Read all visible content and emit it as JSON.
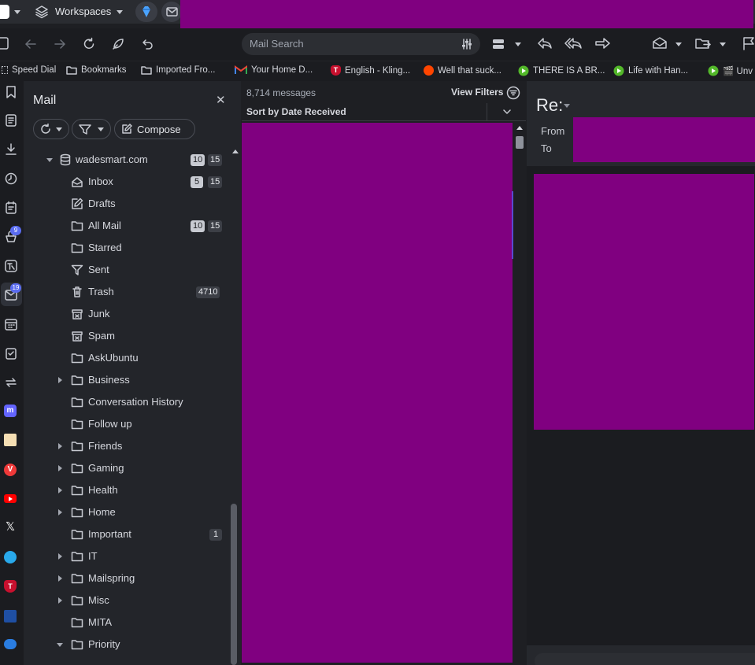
{
  "tabbar": {
    "workspaces_label": "Workspaces"
  },
  "toolbar": {
    "search_placeholder": "Mail Search"
  },
  "bookmarks": [
    {
      "label": "Speed Dial",
      "icon": "grid-icon"
    },
    {
      "label": "Bookmarks",
      "icon": "folder-icon"
    },
    {
      "label": "Imported Fro...",
      "icon": "folder-icon"
    },
    {
      "label": "Your Home D...",
      "icon": "gmail-icon"
    },
    {
      "label": "English - Kling...",
      "icon": "shield-icon"
    },
    {
      "label": "Well that suck...",
      "icon": "reddit-icon"
    },
    {
      "label": "THERE IS A BR...",
      "icon": "play-icon"
    },
    {
      "label": "Life with Han...",
      "icon": "play-icon"
    },
    {
      "label": "🎬 Unv",
      "icon": "play-icon"
    }
  ],
  "rail": {
    "feeds_badge": "9",
    "mail_badge": "19"
  },
  "mail": {
    "title": "Mail",
    "compose_label": "Compose",
    "account": {
      "name": "wadesmart.com",
      "unread": "10",
      "total": "15"
    },
    "folders": [
      {
        "name": "Inbox",
        "icon": "inbox-icon",
        "unread": "5",
        "total": "15",
        "expand": "none"
      },
      {
        "name": "Drafts",
        "icon": "draft-icon",
        "unread": "",
        "total": "",
        "expand": "none"
      },
      {
        "name": "All Mail",
        "icon": "folder-icon",
        "unread": "10",
        "total": "15",
        "expand": "none"
      },
      {
        "name": "Starred",
        "icon": "folder-icon",
        "unread": "",
        "total": "",
        "expand": "none"
      },
      {
        "name": "Sent",
        "icon": "sent-icon",
        "unread": "",
        "total": "",
        "expand": "none"
      },
      {
        "name": "Trash",
        "icon": "trash-icon",
        "unread": "",
        "total": "4710",
        "expand": "none"
      },
      {
        "name": "Junk",
        "icon": "junk-icon",
        "unread": "",
        "total": "",
        "expand": "none"
      },
      {
        "name": "Spam",
        "icon": "junk-icon",
        "unread": "",
        "total": "",
        "expand": "none"
      },
      {
        "name": "AskUbuntu",
        "icon": "folder-icon",
        "unread": "",
        "total": "",
        "expand": "none"
      },
      {
        "name": "Business",
        "icon": "folder-icon",
        "unread": "",
        "total": "",
        "expand": "collapsed"
      },
      {
        "name": "Conversation History",
        "icon": "folder-icon",
        "unread": "",
        "total": "",
        "expand": "none"
      },
      {
        "name": "Follow up",
        "icon": "folder-icon",
        "unread": "",
        "total": "",
        "expand": "none"
      },
      {
        "name": "Friends",
        "icon": "folder-icon",
        "unread": "",
        "total": "",
        "expand": "collapsed"
      },
      {
        "name": "Gaming",
        "icon": "folder-icon",
        "unread": "",
        "total": "",
        "expand": "collapsed"
      },
      {
        "name": "Health",
        "icon": "folder-icon",
        "unread": "",
        "total": "",
        "expand": "collapsed"
      },
      {
        "name": "Home",
        "icon": "folder-icon",
        "unread": "",
        "total": "",
        "expand": "collapsed"
      },
      {
        "name": "Important",
        "icon": "folder-icon",
        "unread": "",
        "total": "1",
        "expand": "none"
      },
      {
        "name": "IT",
        "icon": "folder-icon",
        "unread": "",
        "total": "",
        "expand": "collapsed"
      },
      {
        "name": "Mailspring",
        "icon": "folder-icon",
        "unread": "",
        "total": "",
        "expand": "collapsed"
      },
      {
        "name": "Misc",
        "icon": "folder-icon",
        "unread": "",
        "total": "",
        "expand": "collapsed"
      },
      {
        "name": "MITA",
        "icon": "folder-icon",
        "unread": "",
        "total": "",
        "expand": "none"
      },
      {
        "name": "Priority",
        "icon": "folder-icon",
        "unread": "",
        "total": "",
        "expand": "expanded"
      }
    ]
  },
  "list": {
    "message_count": "8,714 messages",
    "view_filters": "View Filters",
    "sort_label": "Sort by Date Received"
  },
  "reader": {
    "subject": "Re:",
    "from_label": "From",
    "to_label": "To"
  },
  "colors": {
    "redaction": "#800080",
    "accent": "#5a6cf0"
  }
}
